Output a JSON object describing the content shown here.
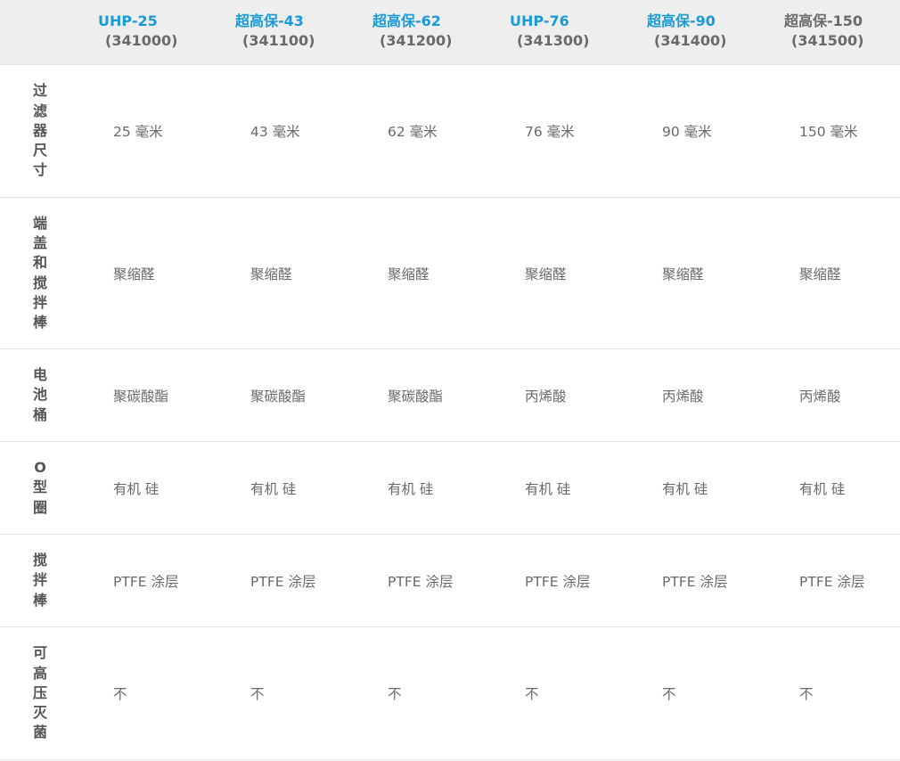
{
  "columns": [
    {
      "name": "UHP-25",
      "code": "(341000)",
      "color": "#1a9bd7"
    },
    {
      "name": "超高保-43",
      "code": "(341100)",
      "color": "#1a9bd7"
    },
    {
      "name": "超高保-62",
      "code": "(341200)",
      "color": "#1a9bd7"
    },
    {
      "name": "UHP-76",
      "code": "(341300)",
      "color": "#1a9bd7"
    },
    {
      "name": "超高保-90",
      "code": "(341400)",
      "color": "#1a9bd7"
    },
    {
      "name": "超高保-150",
      "code": "(341500)",
      "color": "#6a6a6a"
    }
  ],
  "rows": [
    {
      "label": "过滤器尺寸",
      "cells": [
        "25 毫米",
        "43 毫米",
        "62 毫米",
        "76 毫米",
        "90 毫米",
        "150 毫米"
      ]
    },
    {
      "label": "端盖和搅拌棒",
      "cells": [
        "聚缩醛",
        "聚缩醛",
        "聚缩醛",
        "聚缩醛",
        "聚缩醛",
        "聚缩醛"
      ]
    },
    {
      "label": "电池桶",
      "cells": [
        "聚碳酸酯",
        "聚碳酸酯",
        "聚碳酸酯",
        "丙烯酸",
        "丙烯酸",
        "丙烯酸"
      ]
    },
    {
      "label": "O型圈",
      "cells": [
        "有机 硅",
        "有机 硅",
        "有机 硅",
        "有机 硅",
        "有机 硅",
        "有机 硅"
      ]
    },
    {
      "label": "搅拌棒",
      "cells": [
        "PTFE 涂层",
        "PTFE 涂层",
        "PTFE 涂层",
        "PTFE 涂层",
        "PTFE 涂层",
        "PTFE 涂层"
      ]
    },
    {
      "label": "可高压灭菌",
      "cells": [
        "不",
        "不",
        "不",
        "不",
        "不",
        "不"
      ]
    }
  ]
}
